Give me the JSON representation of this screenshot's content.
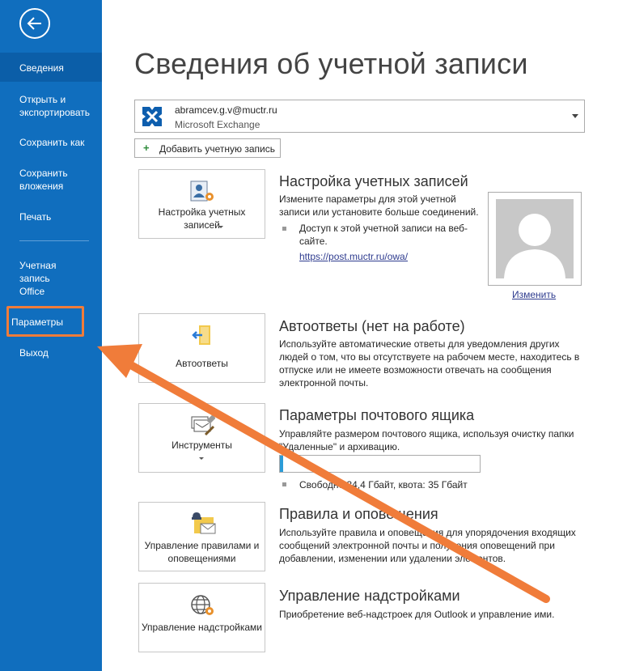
{
  "sidebar": {
    "items": [
      {
        "label": "Сведения"
      },
      {
        "label": "Открыть и экспортировать"
      },
      {
        "label": "Сохранить как"
      },
      {
        "label": "Сохранить вложения"
      },
      {
        "label": "Печать"
      },
      {
        "label": "Учетная запись Office"
      },
      {
        "label": "Параметры"
      },
      {
        "label": "Выход"
      }
    ]
  },
  "page": {
    "title": "Сведения об учетной записи"
  },
  "account": {
    "email": "abramcev.g.v@muctr.ru",
    "type": "Microsoft Exchange"
  },
  "add_account_label": "Добавить учетную запись",
  "sections": {
    "account_settings": {
      "tile_label": "Настройка учетных записей",
      "heading": "Настройка учетных записей",
      "text": "Измените параметры для этой учетной записи или установите больше соединений.",
      "bullet": "Доступ к этой учетной записи на веб-сайте.",
      "link": "https://post.muctr.ru/owa/",
      "change_link": "Изменить"
    },
    "auto_replies": {
      "tile_label": "Автоответы",
      "heading": "Автоответы (нет на работе)",
      "text": "Используйте автоматические ответы для уведомления других людей о том, что вы отсутствуете на рабочем месте, находитесь в отпуске или не имеете возможности отвечать на сообщения электронной почты."
    },
    "mailbox": {
      "tile_label": "Инструменты",
      "heading": "Параметры почтового ящика",
      "text": "Управляйте размером почтового ящика, используя очистку папки \"Удаленные\" и архивацию.",
      "free_text": "Свободно 34,4 Гбайт, квота: 35 Гбайт",
      "used_fraction": 0.017
    },
    "rules": {
      "tile_label": "Управление правилами и оповещениями",
      "heading": "Правила и оповещения",
      "text": "Используйте правила и оповещения для упорядочения входящих сообщений электронной почты и получения оповещений при добавлении, изменении или удалении элементов."
    },
    "addins": {
      "tile_label": "Управление надстройками",
      "heading": "Управление надстройками",
      "text": "Приобретение веб-надстроек для Outlook и управление ими."
    }
  },
  "colors": {
    "sidebar": "#106ebe",
    "annotation": "#f07c3a",
    "progress": "#2b9cd8"
  }
}
